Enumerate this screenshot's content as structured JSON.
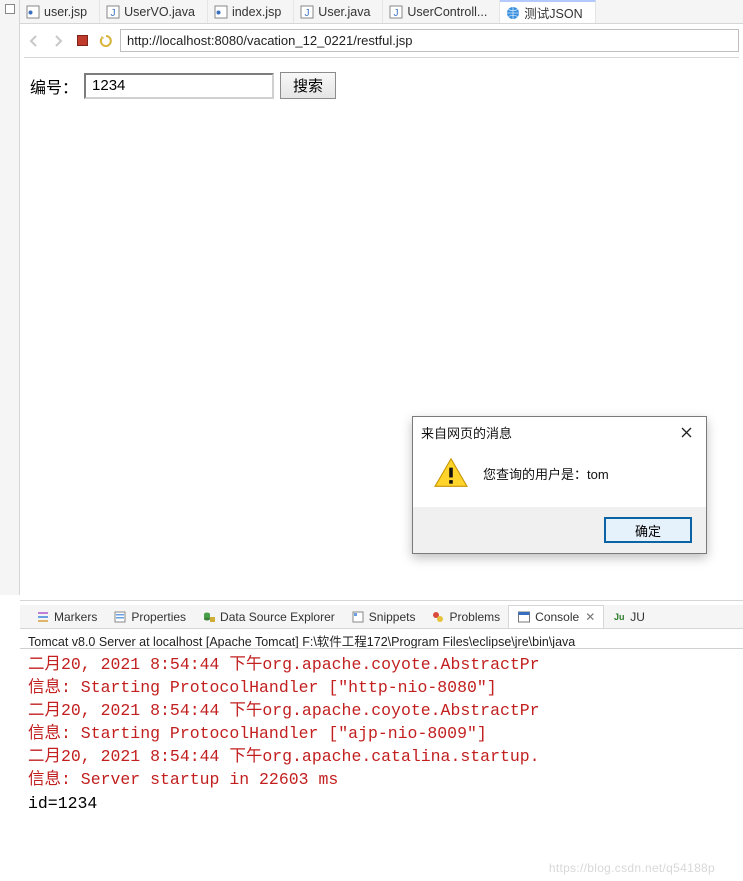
{
  "tabs": [
    {
      "label": "user.jsp",
      "kind": "jsp"
    },
    {
      "label": "UserVO.java",
      "kind": "java"
    },
    {
      "label": "index.jsp",
      "kind": "jsp"
    },
    {
      "label": "User.java",
      "kind": "java"
    },
    {
      "label": "UserControll...",
      "kind": "java"
    },
    {
      "label": "测试JSON",
      "kind": "globe",
      "active": true
    }
  ],
  "toolbar": {
    "url": "http://localhost:8080/vacation_12_0221/restful.jsp"
  },
  "page": {
    "label": "编号：",
    "input_value": "1234",
    "search_label": "搜索"
  },
  "alert": {
    "title": "来自网页的消息",
    "message": "您查询的用户是：tom",
    "ok_label": "确定"
  },
  "views": [
    {
      "label": "Markers",
      "icon": "markers"
    },
    {
      "label": "Properties",
      "icon": "properties"
    },
    {
      "label": "Data Source Explorer",
      "icon": "data-source"
    },
    {
      "label": "Snippets",
      "icon": "snippets"
    },
    {
      "label": "Problems",
      "icon": "problems"
    },
    {
      "label": "Console",
      "icon": "console",
      "active": true,
      "closeable": true
    },
    {
      "label": "JU",
      "icon": "junit"
    }
  ],
  "console": {
    "breadcrumb": "Tomcat v8.0 Server at localhost [Apache Tomcat] F:\\软件工程172\\Program Files\\eclipse\\jre\\bin\\java",
    "lines": [
      {
        "cls": "red",
        "text": "二月20, 2021 8:54:44 下午org.apache.coyote.AbstractPr"
      },
      {
        "cls": "red",
        "text": "信息: Starting ProtocolHandler [\"http-nio-8080\"]"
      },
      {
        "cls": "red",
        "text": "二月20, 2021 8:54:44 下午org.apache.coyote.AbstractPr"
      },
      {
        "cls": "red",
        "text": "信息: Starting ProtocolHandler [\"ajp-nio-8009\"]"
      },
      {
        "cls": "red",
        "text": "二月20, 2021 8:54:44 下午org.apache.catalina.startup."
      },
      {
        "cls": "red",
        "text": "信息: Server startup in 22603 ms"
      },
      {
        "cls": "blk",
        "text": "id=1234"
      }
    ]
  },
  "watermark": "https://blog.csdn.net/q54188p"
}
